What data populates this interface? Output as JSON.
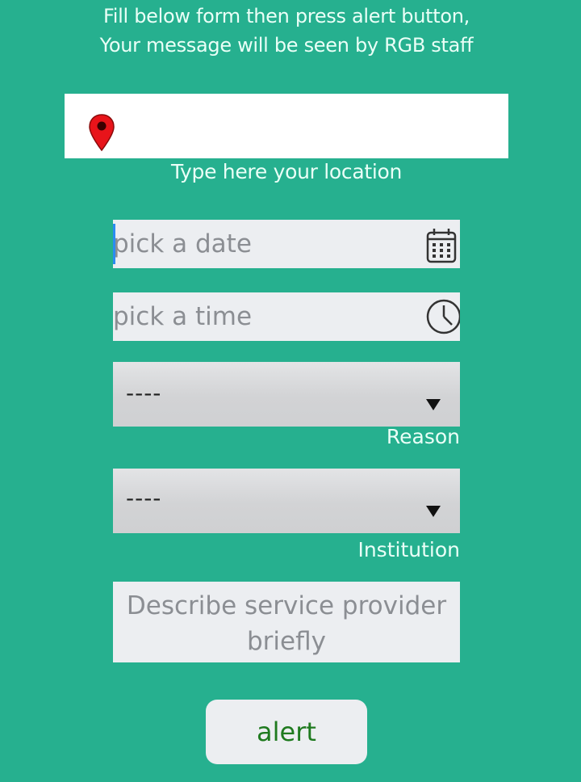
{
  "intro": {
    "line1": "Fill below form then press alert button,",
    "line2": "Your message will be seen by RGB staff"
  },
  "location": {
    "value": "",
    "icon": "map-pin-icon",
    "label": "Type here your location"
  },
  "date": {
    "value": "",
    "placeholder": "pick a date",
    "icon": "calendar-icon"
  },
  "time": {
    "value": "",
    "placeholder": "pick a time",
    "icon": "clock-icon"
  },
  "reason": {
    "selected": "----",
    "label": "Reason"
  },
  "institution": {
    "selected": "----",
    "label": "Institution"
  },
  "description": {
    "value": "",
    "placeholder": "Describe service provider briefly"
  },
  "alert_button": {
    "label": "alert"
  },
  "colors": {
    "background": "#26b08f",
    "field_background": "#eceef1",
    "button_text": "#1f7a1f",
    "pin": "#e8141a",
    "cursor": "#2b8cf0"
  }
}
